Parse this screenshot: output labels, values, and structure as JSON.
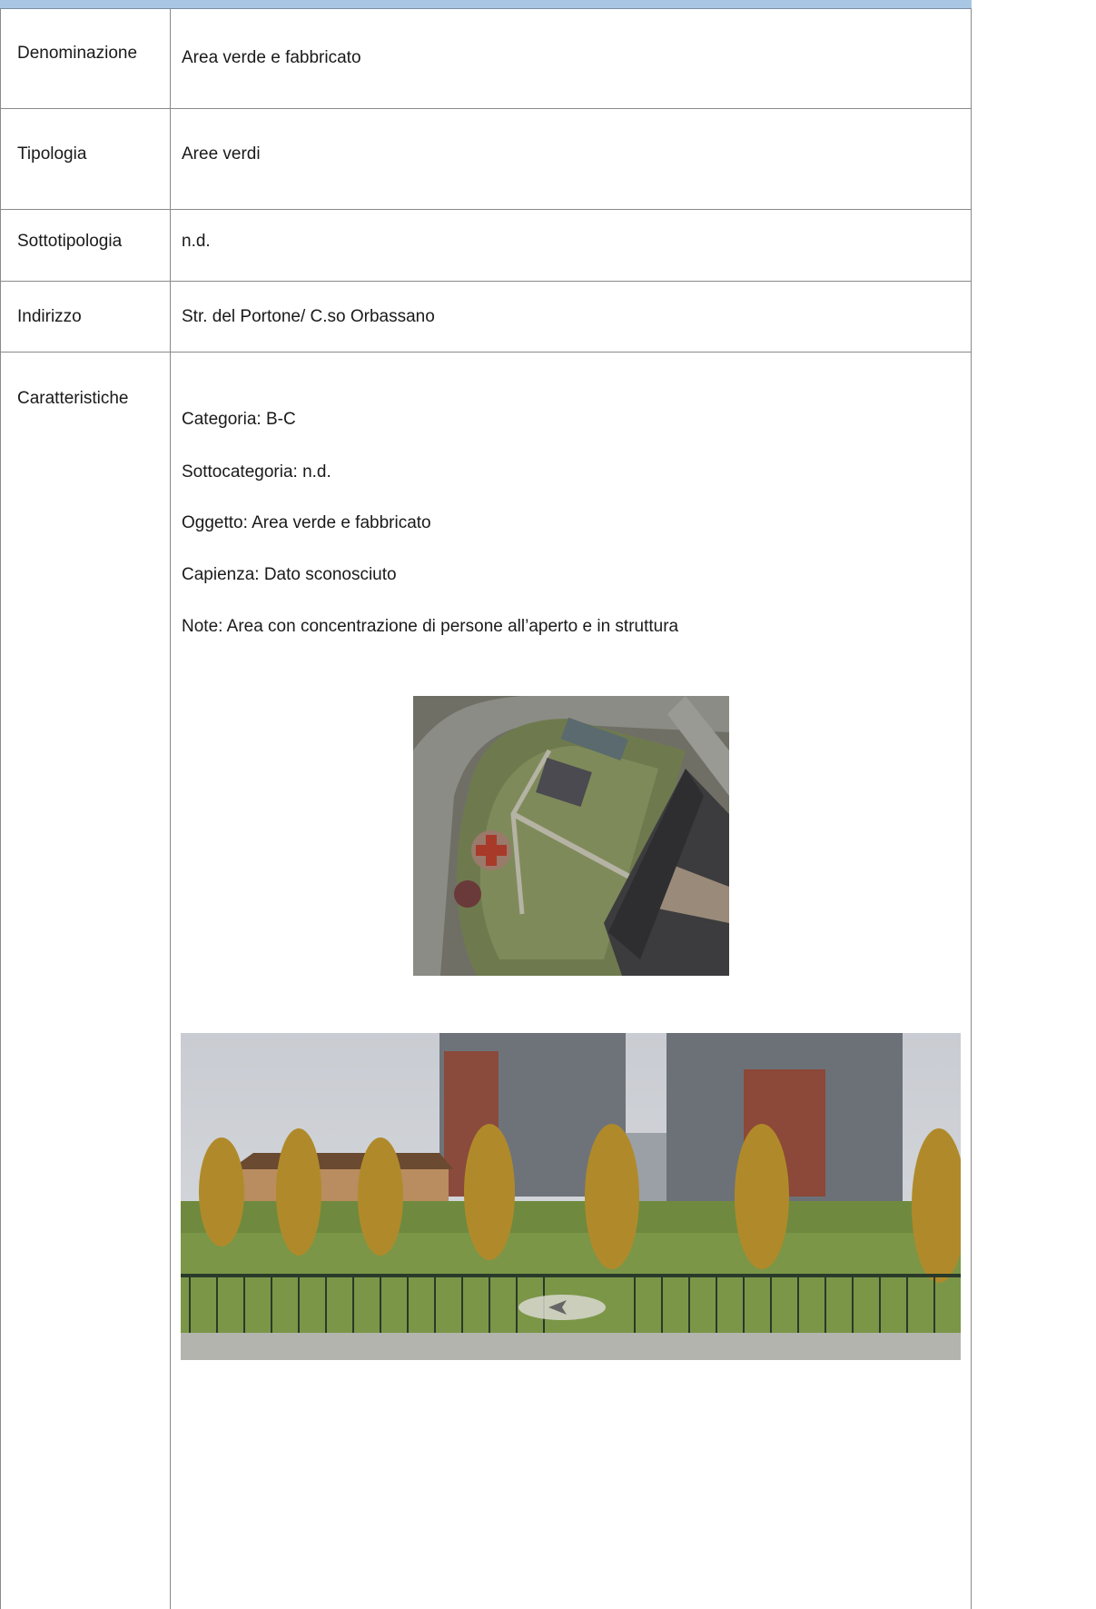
{
  "rows": [
    {
      "label": "Denominazione",
      "value": "Area verde e fabbricato"
    },
    {
      "label": "Tipologia",
      "value": "Aree verdi"
    },
    {
      "label": "Sottotipologia",
      "value": "n.d."
    },
    {
      "label": "Indirizzo",
      "value": "Str. del Portone/ C.so Orbassano"
    },
    {
      "label": "Caratteristiche"
    }
  ],
  "features": [
    "Categoria: B-C",
    "Sottocategoria: n.d.",
    "Oggetto: Area verde e fabbricato",
    "Capienza: Dato sconosciuto",
    "Note: Area con concentrazione di persone all’aperto e in struttura"
  ],
  "colors": {
    "header_band": "#a9c6e4",
    "grid": "#8a8a8a"
  },
  "images": [
    "aerial-photo",
    "street-view-photo"
  ]
}
